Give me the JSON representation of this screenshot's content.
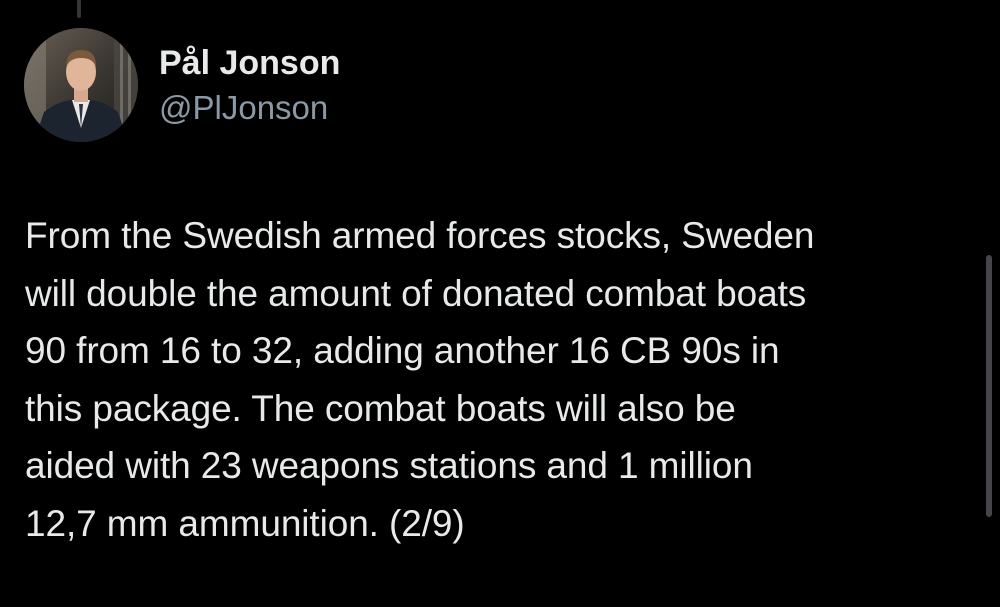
{
  "tweet": {
    "author": {
      "display_name": "Pål Jonson",
      "handle": "@PlJonson",
      "avatar_icon": "profile-photo"
    },
    "text": "From the Swedish armed forces stocks, Sweden\nwill double the amount of donated combat boats\n90 from 16 to 32, adding another 16 CB 90s in\nthis package. The combat boats will also be\naided with 23 weapons stations and 1 million\n12,7 mm ammunition. (2/9)"
  },
  "colors": {
    "background": "#000000",
    "primary_text": "#e7e9ea",
    "secondary_text": "#8b98a5",
    "thread_line": "#333639"
  }
}
